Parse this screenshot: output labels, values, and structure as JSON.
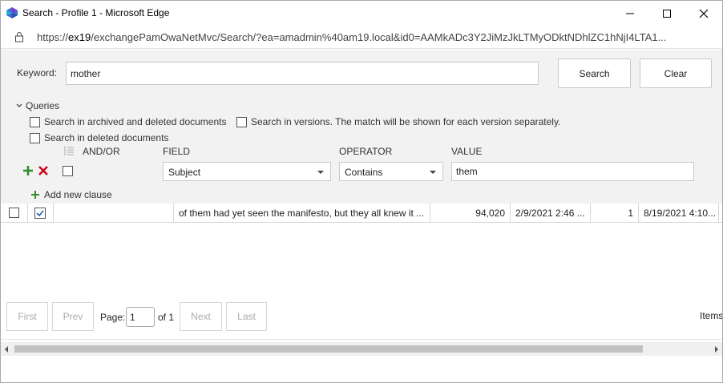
{
  "window": {
    "title": "Search - Profile 1 - Microsoft Edge",
    "url_prefix": "https://",
    "url_host": "ex19",
    "url_rest": "/exchangePamOwaNetMvc/Search/?ea=amadmin%40am19.local&id0=AAMkADc3Y2JiMzJkLTMyODktNDhlZC1hNjI4LTA1..."
  },
  "search": {
    "keyword_label": "Keyword:",
    "keyword_value": "mother",
    "search_button": "Search",
    "clear_button": "Clear"
  },
  "queries": {
    "toggle_label": "Queries",
    "options": [
      {
        "label": "Search in archived and deleted documents",
        "checked": false
      },
      {
        "label": "Search in versions. The match will be shown for each version separately.",
        "checked": false
      },
      {
        "label": "Search in deleted documents",
        "checked": false
      }
    ],
    "headers": {
      "andor": "AND/OR",
      "field": "FIELD",
      "operator": "OPERATOR",
      "value": "VALUE"
    },
    "clause": {
      "field": "Subject",
      "operator": "Contains",
      "value": "them"
    },
    "add_clause": "Add new clause"
  },
  "results": {
    "rows": [
      {
        "checked": true,
        "col2": "",
        "snippet": "of them had yet seen the manifesto, but they all knew it ...",
        "size": "94,020",
        "date1": "2/9/2021 2:46 ...",
        "count": "1",
        "date2": "8/19/2021 4:10..."
      }
    ]
  },
  "pager": {
    "first": "First",
    "prev": "Prev",
    "page_label": "Page:",
    "page_value": "1",
    "of_label": "of 1",
    "next": "Next",
    "last": "Last",
    "items_label": "Items"
  },
  "colors": {
    "panel_bg": "#f2f2f2",
    "green": "#2e8b2e",
    "red": "#d0021b"
  }
}
